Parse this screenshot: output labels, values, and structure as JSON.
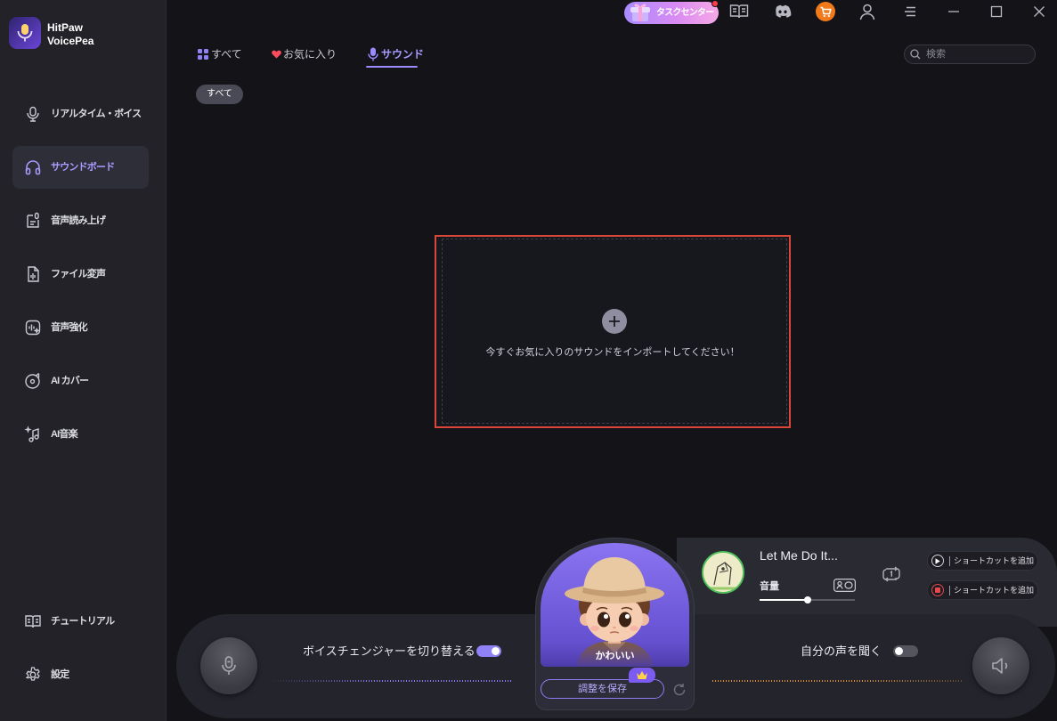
{
  "app": {
    "title_line1": "HitPaw",
    "title_line2": "VoicePea",
    "logo_icon": "voicepea-logo-icon"
  },
  "theme": {
    "accent": "#9a8cff",
    "background": "#131318",
    "sidebar": "#222228",
    "dropzone_highlight": "#d9473b",
    "task_center_gradient": [
      "#a98bff",
      "#f6a8e6"
    ],
    "cart": "#f27a1a",
    "listen_wave": "#d9903a",
    "record": "#e5484d"
  },
  "topbar": {
    "task_center_label": "タスクセンター",
    "task_center_badge": true,
    "icons": [
      "gift-icon",
      "book-icon",
      "discord-icon",
      "cart-icon",
      "user-icon",
      "menu-icon",
      "minimize-icon",
      "maximize-icon",
      "close-icon"
    ]
  },
  "sidebar": {
    "items": [
      {
        "label": "リアルタイム・ボイス",
        "icon": "microphone-icon",
        "active": false
      },
      {
        "label": "サウンドボード",
        "icon": "headphones-icon",
        "active": true
      },
      {
        "label": "音声読み上げ",
        "icon": "text-to-speech-icon",
        "active": false
      },
      {
        "label": "ファイル変声",
        "icon": "audio-file-icon",
        "active": false
      },
      {
        "label": "音声強化",
        "icon": "voice-enhance-icon",
        "active": false
      },
      {
        "label": "AI カバー",
        "icon": "vinyl-icon",
        "active": false
      },
      {
        "label": "AI音楽",
        "icon": "music-note-icon",
        "active": false
      }
    ],
    "footer_items": [
      {
        "label": "チュートリアル",
        "icon": "book-icon"
      },
      {
        "label": "設定",
        "icon": "gear-icon"
      }
    ]
  },
  "tabs": [
    {
      "label": "すべて",
      "icon": "grid-icon",
      "active": false
    },
    {
      "label": "お気に入り",
      "icon": "heart-icon",
      "active": false
    },
    {
      "label": "サウンド",
      "icon": "microphone-icon",
      "active": true
    }
  ],
  "search": {
    "placeholder": "検索",
    "icon": "search-icon"
  },
  "filters": [
    {
      "label": "すべて",
      "selected": true
    }
  ],
  "dropzone": {
    "icon": "plus-icon",
    "message": "今すぐお気に入りのサウンドをインポートしてください！"
  },
  "player": {
    "voice_changer": {
      "label": "ボイスチェンジャーを切り替える",
      "enabled": true
    },
    "listen": {
      "label": "自分の声を聞く",
      "enabled": false
    },
    "avatar": {
      "name": "かわいい",
      "save_label": "調整を保存",
      "badge_icon": "crown-icon"
    },
    "now_playing": {
      "title": "Let Me Do It...",
      "volume_label": "音量",
      "volume_level": 0.5,
      "loop_icon": "repeat-one-icon"
    },
    "shortcuts": [
      {
        "label": "ショートカットを追加",
        "icon": "play-icon"
      },
      {
        "label": "ショートカットを追加",
        "icon": "record-icon"
      }
    ]
  }
}
